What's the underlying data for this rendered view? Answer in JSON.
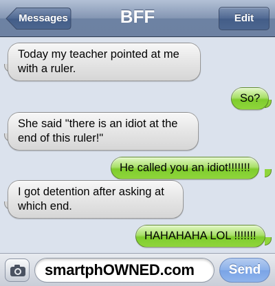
{
  "navbar": {
    "title": "BFF",
    "back_label": "Messages",
    "edit_label": "Edit"
  },
  "messages": [
    {
      "side": "received",
      "text": "Today my teacher pointed at me with a ruler."
    },
    {
      "side": "sent",
      "text": "So?"
    },
    {
      "side": "received",
      "text": "She said \"there is an idiot at the end of this ruler!\""
    },
    {
      "side": "sent",
      "text": "He called you an idiot!!!!!!!"
    },
    {
      "side": "received",
      "text": "I got detention after asking at which end."
    },
    {
      "side": "sent",
      "text": "HAHAHAHA LOL !!!!!!!"
    }
  ],
  "input_bar": {
    "camera_icon": "camera-icon",
    "text_value": "smartphOWNED.com",
    "send_label": "Send"
  },
  "colors": {
    "navbar": "#6d82a3",
    "sent_bubble": "#7fcd2d",
    "received_bubble": "#e4e4e4",
    "background": "#dbe2ed",
    "send_button": "#8ab0ea"
  }
}
